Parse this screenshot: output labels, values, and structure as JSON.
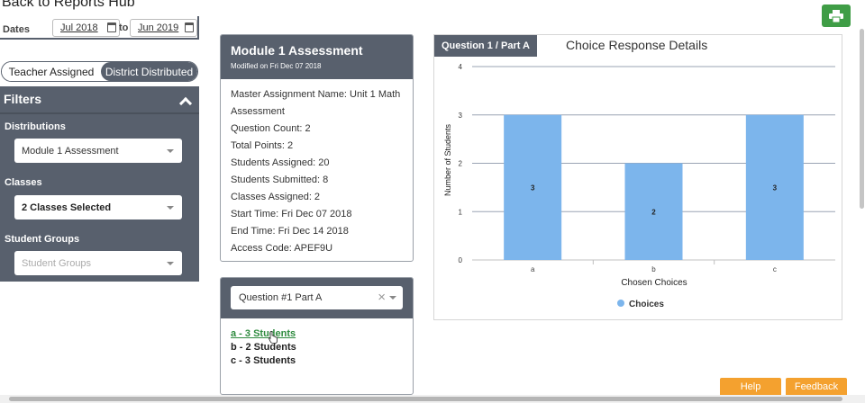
{
  "header": {
    "back_link": "Back to Reports Hub"
  },
  "dates": {
    "label": "Dates",
    "from": "Jul 2018",
    "to_label": "to",
    "to": "Jun 2019"
  },
  "toggle": {
    "teacher_assigned": "Teacher Assigned",
    "district_distributed": "District Distributed",
    "active": "district_distributed"
  },
  "filters": {
    "title": "Filters",
    "distributions_label": "Distributions",
    "distributions_value": "Module 1 Assessment",
    "classes_label": "Classes",
    "classes_value": "2 Classes Selected",
    "student_groups_label": "Student Groups",
    "student_groups_placeholder": "Student Groups"
  },
  "assessment": {
    "title": "Module 1 Assessment",
    "modified": "Modified on Fri Dec 07 2018",
    "lines": [
      "Master Assignment Name: Unit 1 Math",
      "Assessment",
      "Question Count: 2",
      "Total Points: 2",
      "Students Assigned: 20",
      "Students Submitted: 8",
      "Classes Assigned: 2",
      "Start Time: Fri Dec 07 2018",
      "End Time: Fri Dec 14 2018",
      "Access Code: APEF9U"
    ]
  },
  "question": {
    "selected": "Question #1 Part A",
    "responses": [
      "a - 3 Students",
      "b - 2 Students",
      "c - 3 Students"
    ]
  },
  "chart_panel": {
    "tab_label": "Question 1 /  Part A"
  },
  "chart_data": {
    "type": "bar",
    "title": "Choice Response Details",
    "xlabel": "Chosen Choices",
    "ylabel": "Number of Students",
    "categories": [
      "a",
      "b",
      "c"
    ],
    "series": [
      {
        "name": "Choices",
        "values": [
          3,
          2,
          3
        ],
        "color": "#7cb5ec"
      }
    ],
    "ylim": [
      0,
      4
    ],
    "yticks": [
      0,
      1,
      2,
      3,
      4
    ],
    "grid": true,
    "legend": "bottom-center",
    "data_labels": true
  },
  "footer": {
    "help": "Help",
    "feedback": "Feedback"
  },
  "colors": {
    "panel": "#58606d",
    "accent_green": "#3f9d46",
    "accent_orange": "#f4a12f",
    "link_green": "#2e8b3e",
    "bar": "#7cb5ec"
  },
  "icons": [
    "print-icon",
    "calendar-icon",
    "chevron-up-icon",
    "caret-down-icon",
    "clear-icon",
    "cursor-icon"
  ]
}
